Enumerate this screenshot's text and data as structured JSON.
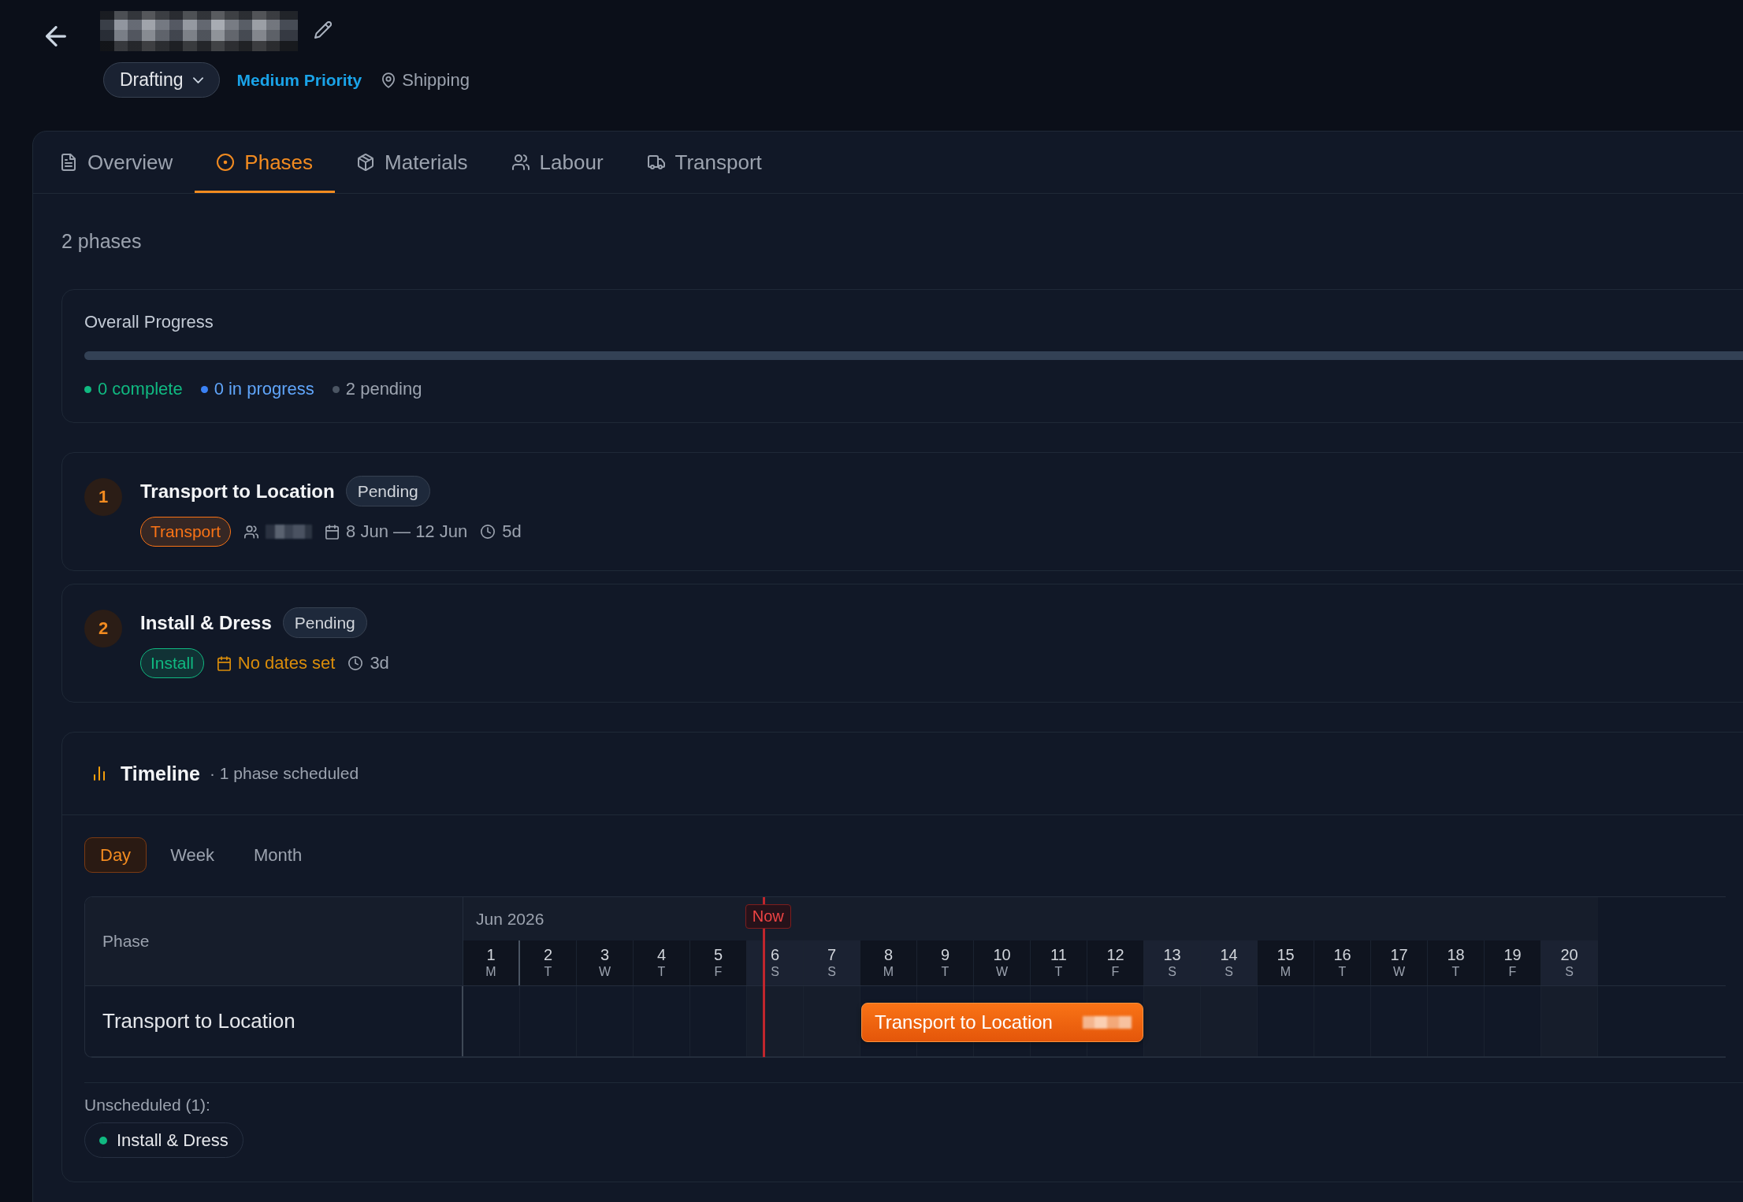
{
  "header": {
    "status": "Drafting",
    "priority": "Medium Priority",
    "location": "Shipping"
  },
  "tabs": [
    {
      "label": "Overview",
      "selected": false
    },
    {
      "label": "Phases",
      "selected": true
    },
    {
      "label": "Materials",
      "selected": false
    },
    {
      "label": "Labour",
      "selected": false
    },
    {
      "label": "Transport",
      "selected": false
    }
  ],
  "phase_count": "2 phases",
  "progress": {
    "title": "Overall Progress",
    "level": 0,
    "legend": [
      {
        "kind": "complete",
        "label": "0 complete",
        "color": "#10b981"
      },
      {
        "kind": "in_progress",
        "label": "0 in progress",
        "color": "#3b82f6"
      },
      {
        "kind": "pending",
        "label": "2 pending",
        "color": "#4b5563"
      }
    ]
  },
  "phases": [
    {
      "number": "1",
      "title": "Transport to Location",
      "status": "Pending",
      "tag": {
        "label": "Transport",
        "color": "#f97316"
      },
      "has_assignee": true,
      "scheduled": true,
      "dates": "8 Jun — 12 Jun",
      "duration": "5d"
    },
    {
      "number": "2",
      "title": "Install & Dress",
      "status": "Pending",
      "tag": {
        "label": "Install",
        "color": "#10b981"
      },
      "has_assignee": false,
      "scheduled": false,
      "dates": "No dates set",
      "duration": "3d"
    }
  ],
  "timeline": {
    "title": "Timeline",
    "subtitle": "· 1 phase scheduled",
    "views": [
      {
        "label": "Day",
        "selected": true
      },
      {
        "label": "Week",
        "selected": false
      },
      {
        "label": "Month",
        "selected": false
      }
    ],
    "gantt": {
      "phase_header": "Phase",
      "month": "Jun 2026",
      "now_label": "Now",
      "days": [
        {
          "day": "1",
          "weekday": "M",
          "weekend": false,
          "now": false
        },
        {
          "day": "2",
          "weekday": "T",
          "weekend": false,
          "now": false
        },
        {
          "day": "3",
          "weekday": "W",
          "weekend": false,
          "now": false
        },
        {
          "day": "4",
          "weekday": "T",
          "weekend": false,
          "now": false
        },
        {
          "day": "5",
          "weekday": "F",
          "weekend": false,
          "now": false
        },
        {
          "day": "6",
          "weekday": "S",
          "weekend": true,
          "now": true
        },
        {
          "day": "7",
          "weekday": "S",
          "weekend": true,
          "now": false
        },
        {
          "day": "8",
          "weekday": "M",
          "weekend": false,
          "now": false
        },
        {
          "day": "9",
          "weekday": "T",
          "weekend": false,
          "now": false
        },
        {
          "day": "10",
          "weekday": "W",
          "weekend": false,
          "now": false
        },
        {
          "day": "11",
          "weekday": "T",
          "weekend": false,
          "now": false
        },
        {
          "day": "12",
          "weekday": "F",
          "weekend": false,
          "now": false
        },
        {
          "day": "13",
          "weekday": "S",
          "weekend": true,
          "now": false
        },
        {
          "day": "14",
          "weekday": "S",
          "weekend": true,
          "now": false
        },
        {
          "day": "15",
          "weekday": "M",
          "weekend": false,
          "now": false
        },
        {
          "day": "16",
          "weekday": "T",
          "weekend": false,
          "now": false
        },
        {
          "day": "17",
          "weekday": "W",
          "weekend": false,
          "now": false
        },
        {
          "day": "18",
          "weekday": "T",
          "weekend": false,
          "now": false
        },
        {
          "day": "19",
          "weekday": "F",
          "weekend": false,
          "now": false
        },
        {
          "day": "20",
          "weekday": "S",
          "weekend": true,
          "now": false
        }
      ],
      "rows": [
        {
          "label": "Transport to Location",
          "bar_label": "Transport to Location",
          "cells": [
            {
              "in_bar": false
            },
            {
              "in_bar": false
            },
            {
              "in_bar": false
            },
            {
              "in_bar": false
            },
            {
              "in_bar": false
            },
            {
              "in_bar": false
            },
            {
              "in_bar": false
            },
            {
              "in_bar": true
            },
            {
              "in_bar": true
            },
            {
              "in_bar": true
            },
            {
              "in_bar": true
            },
            {
              "in_bar": true
            },
            {
              "in_bar": false
            },
            {
              "in_bar": false
            },
            {
              "in_bar": false
            },
            {
              "in_bar": false
            },
            {
              "in_bar": false
            },
            {
              "in_bar": false
            },
            {
              "in_bar": false
            },
            {
              "in_bar": false
            }
          ]
        }
      ]
    },
    "unscheduled": {
      "label": "Unscheduled (1):",
      "items": [
        {
          "label": "Install & Dress",
          "color": "#10b981"
        }
      ]
    }
  }
}
